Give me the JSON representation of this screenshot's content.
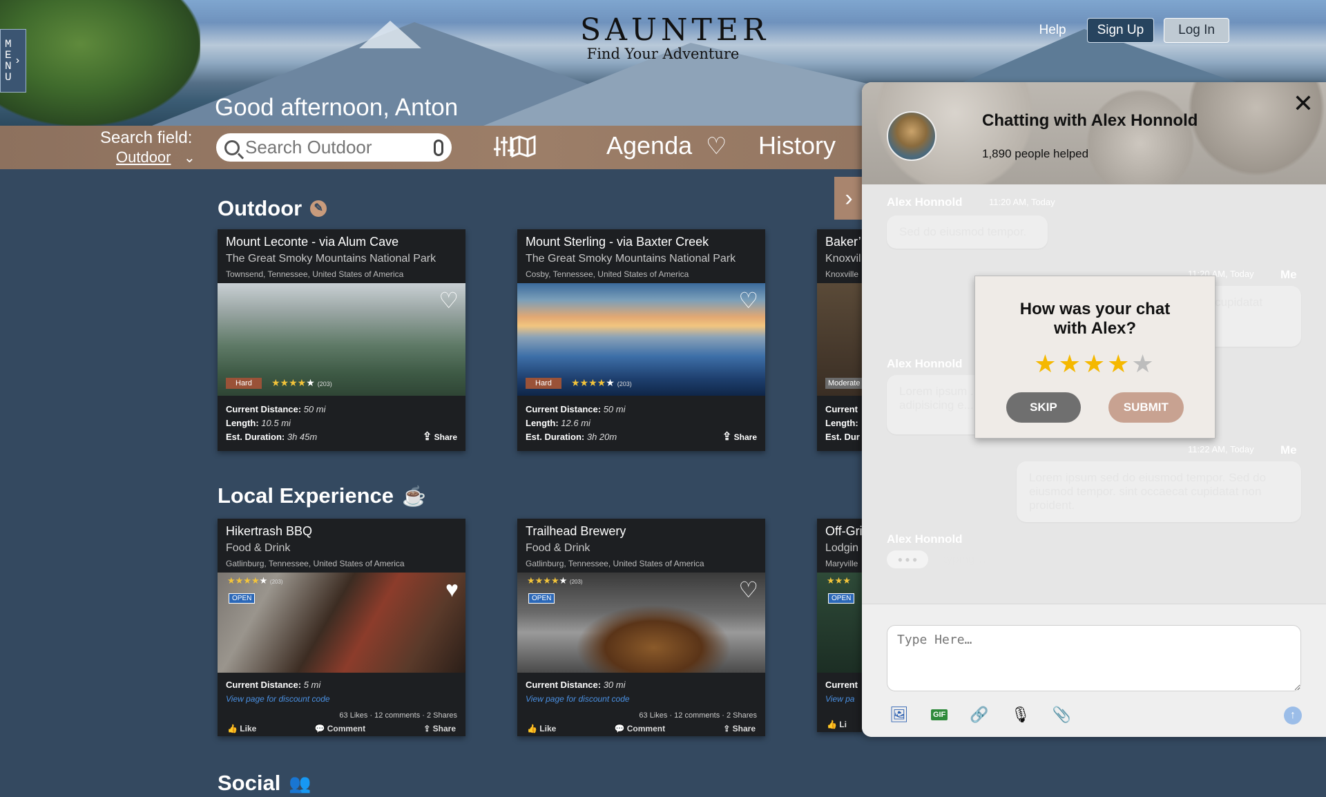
{
  "header": {
    "menu_letters": [
      "M",
      "E",
      "N",
      "U"
    ],
    "brand": "SAUNTER",
    "tagline": "Find Your Adventure",
    "help": "Help",
    "sign_up": "Sign Up",
    "log_in": "Log In",
    "greeting": "Good afternoon, Anton"
  },
  "search": {
    "field_label": "Search field:",
    "field_value": "Outdoor",
    "placeholder": "Search Outdoor"
  },
  "nav": {
    "agenda": "Agenda",
    "history": "History"
  },
  "sections": {
    "outdoor": "Outdoor",
    "local": "Local Experience",
    "social": "Social"
  },
  "outdoor_cards": [
    {
      "title": "Mount Leconte - via Alum Cave",
      "park": "The Great Smoky Mountains National Park",
      "location": "Townsend, Tennessee, United States of America",
      "difficulty": "Hard",
      "reviews": "(203)",
      "distance_label": "Current Distance:",
      "distance": "50 mi",
      "length_label": "Length:",
      "length": "10.5 mi",
      "duration_label": "Est. Duration:",
      "duration": "3h 45m",
      "share": "Share"
    },
    {
      "title": "Mount Sterling - via Baxter Creek",
      "park": "The Great Smoky Mountains National Park",
      "location": "Cosby, Tennessee, United States of America",
      "difficulty": "Hard",
      "reviews": "(203)",
      "distance_label": "Current Distance:",
      "distance": "50 mi",
      "length_label": "Length:",
      "length": "12.6 mi",
      "duration_label": "Est. Duration:",
      "duration": "3h 20m",
      "share": "Share"
    },
    {
      "title": "Baker’",
      "park": "Knoxvil",
      "location": "Knoxville",
      "difficulty": "Moderate",
      "distance_label": "Current",
      "length_label": "Length:",
      "duration_label": "Est. Dur"
    }
  ],
  "local_cards": [
    {
      "title": "Hikertrash BBQ",
      "category": "Food & Drink",
      "location": "Gatlinburg, Tennessee, United States of America",
      "reviews": "(203)",
      "open": "OPEN",
      "distance_label": "Current Distance:",
      "distance": "5 mi",
      "discount": "View page for discount code",
      "stats": "63 Likes · 12 comments · 2 Shares",
      "like": "Like",
      "comment": "Comment",
      "share": "Share"
    },
    {
      "title": "Trailhead Brewery",
      "category": "Food & Drink",
      "location": "Gatlinburg, Tennessee, United States of America",
      "reviews": "(203)",
      "open": "OPEN",
      "distance_label": "Current Distance:",
      "distance": "30 mi",
      "discount": "View page for discount code",
      "stats": "63 Likes · 12 comments · 2 Shares",
      "like": "Like",
      "comment": "Comment",
      "share": "Share"
    },
    {
      "title": "Off-Gri",
      "category": "Lodgin",
      "location": "Maryville",
      "open": "OPEN",
      "distance_label": "Current",
      "discount": "View pa",
      "like": "Li"
    }
  ],
  "chat": {
    "title": "Chatting with Alex Honnold",
    "helped": "1,890 people helped",
    "sender": "Alex Honnold",
    "me": "Me",
    "messages": [
      {
        "time": "11:20 AM, Today",
        "text": "Sed do eiusmod tempor."
      },
      {
        "time": "11:20 AM, Today",
        "text": "...at cupidatat"
      },
      {
        "text": "Lorem ipsum ... adipisicing e..."
      },
      {
        "time": "11:22 AM, Today",
        "text": "Lorem ipsum sed do eiusmod tempor. Sed do eiusmod tempor. sint occaecat cupidatat non proident."
      }
    ],
    "typing": "typing…",
    "input_placeholder": "Type Here…"
  },
  "rating_modal": {
    "title_line1": "How was your chat",
    "title_line2": "with Alex?",
    "stars_selected": 4,
    "stars_total": 5,
    "skip": "SKIP",
    "submit": "SUBMIT"
  },
  "colors": {
    "page_bg": "#344960",
    "bar_brown": "#9c7e68",
    "star": "#f5b800",
    "accent_blue": "#4a90e2"
  }
}
